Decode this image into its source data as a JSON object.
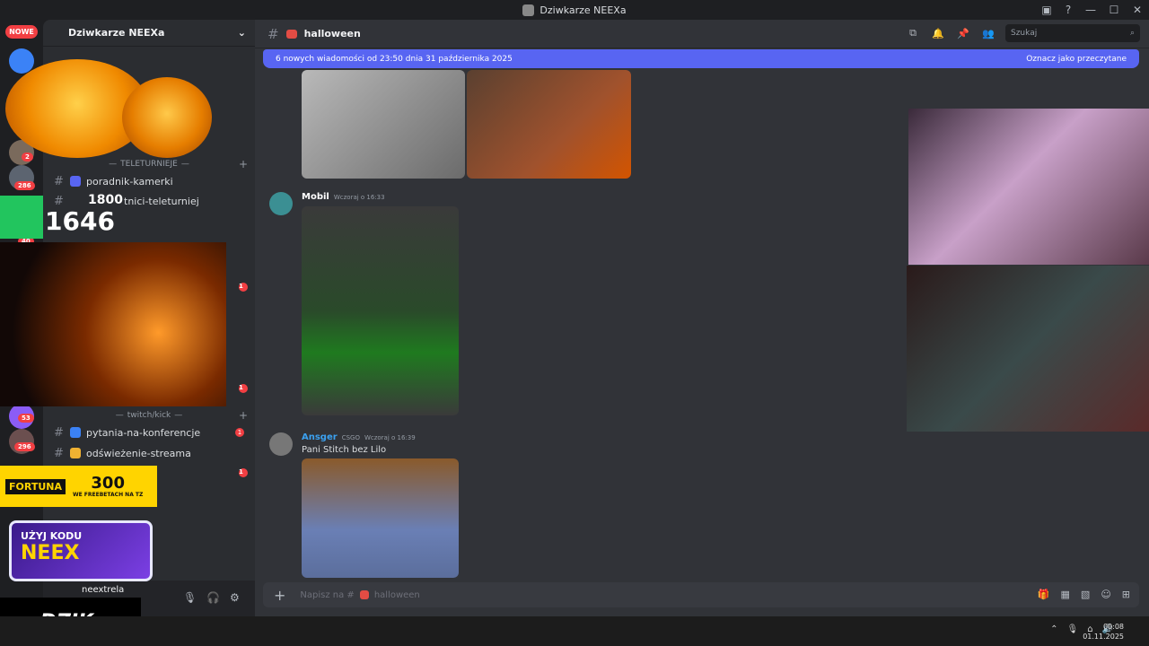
{
  "titlebar": {
    "title": "Dziwkarze NEEXa"
  },
  "serverbar": {
    "new_badge": "NOWE",
    "badges": [
      "2",
      "286",
      "40",
      "53",
      "296"
    ]
  },
  "sidebar": {
    "server_name": "Dziwkarze NEEXa",
    "categories": {
      "teleturnieje": "TELETURNIEJE",
      "twitch_kick": "twitch/kick"
    },
    "channels": {
      "poradnik": "poradnik-kamerki",
      "uczestnicy": "tnici-teleturniej",
      "pytania": "pytania-na-konferencje",
      "odswiezenie": "odświeżenie-streama"
    },
    "user": {
      "name": "neextrela"
    },
    "unread": [
      "1",
      "1",
      "1",
      "1"
    ]
  },
  "header": {
    "channel_name": "halloween",
    "search_placeholder": "Szukaj"
  },
  "banner": {
    "text": "6 nowych wiadomości od 23:50 dnia 31 października 2025",
    "action": "Oznacz jako przeczytane"
  },
  "messages": [
    {
      "author": "Mobil",
      "time": "Wczoraj o 16:33",
      "text": ""
    },
    {
      "author": "Ansger",
      "tag": "CSGO",
      "time": "Wczoraj o 16:39",
      "text": "Pani Stitch bez Lilo"
    }
  ],
  "composer": {
    "placeholder_prefix": "Napisz na #",
    "placeholder_channel": "halloween"
  },
  "overlay": {
    "counter_top": "1800",
    "counter_main": "1646",
    "promo_fortuna": "FORTUNA",
    "promo_amount": "300",
    "promo_sub": "WE FREEBETACH NA TZ",
    "promo_code_label": "UŻYJ KODU",
    "promo_code": "NEEX",
    "brand": "DZIK."
  },
  "taskbar": {
    "time": "00:08",
    "date": "01.11.2025"
  },
  "colors": {
    "blurple": "#5865f2",
    "sidebar": "#2b2d31",
    "chat_bg": "#313338",
    "mobil_name": "#ffffff",
    "ansger_name": "#3ba1f0"
  }
}
